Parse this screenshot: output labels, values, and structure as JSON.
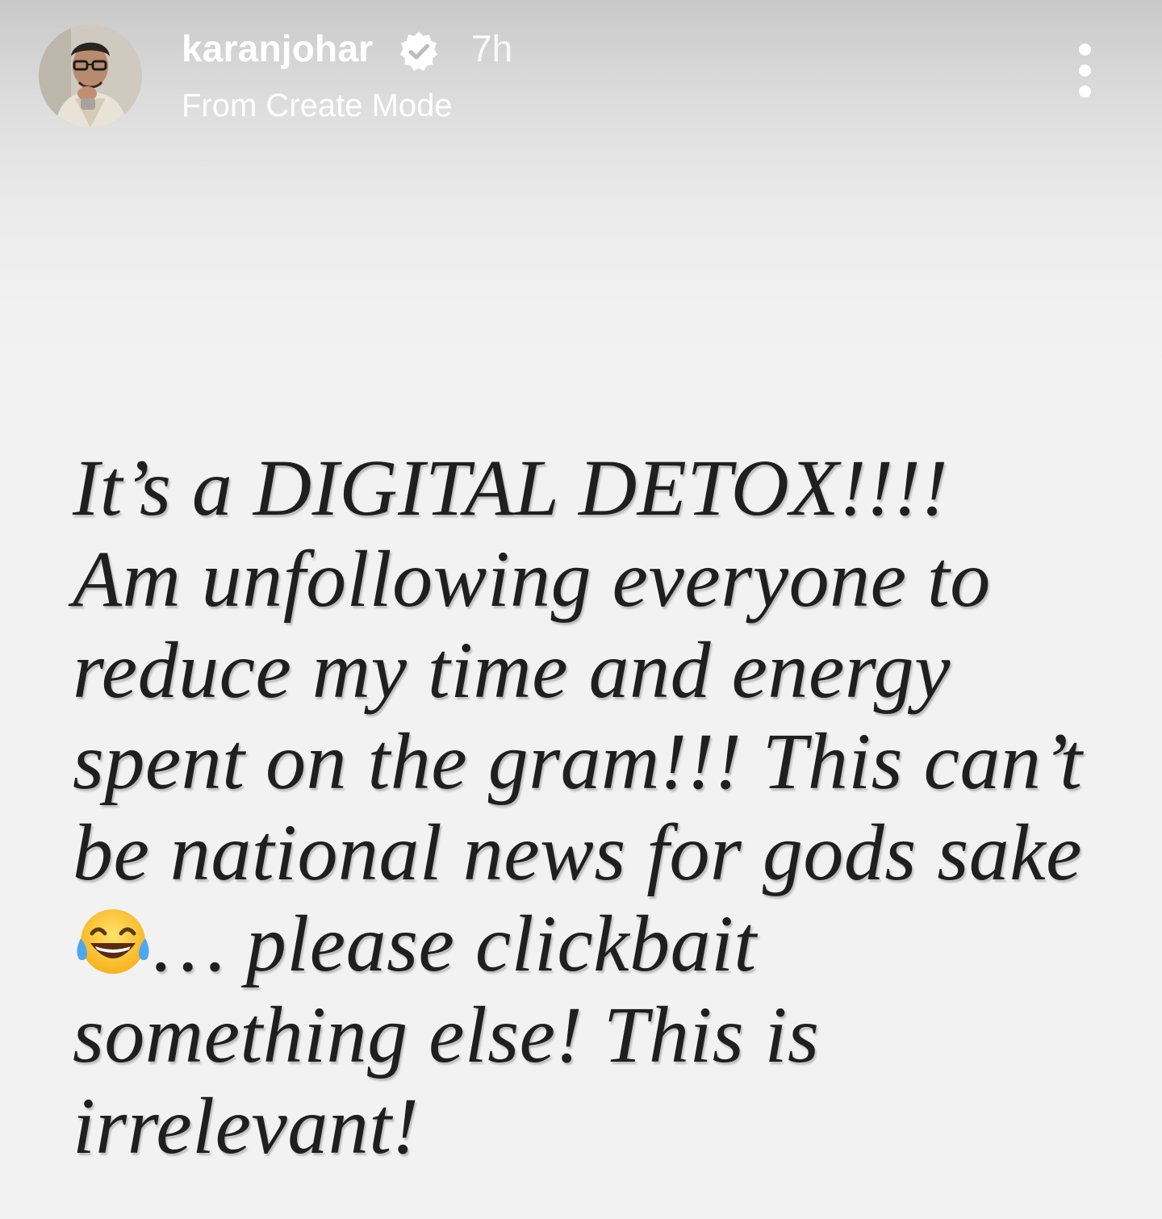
{
  "story": {
    "username": "karanjohar",
    "verified": true,
    "timestamp": "7h",
    "subtitle": "From Create Mode",
    "avatar_icon": "profile-photo",
    "more_icon": "more-vertical-icon"
  },
  "caption": {
    "lines": [
      "It’s a DIGITAL DETOX!!!!",
      "Am unfollowing everyone to",
      "reduce my time and energy",
      "spent on the gram!!! This can’t",
      "be national news for gods sake",
      "… please clickbait",
      "something else! This is",
      "irrelevant!"
    ],
    "emoji": "face-with-tears-of-joy"
  },
  "colors": {
    "header_text": "#ffffff",
    "caption_text": "#1f1f1f",
    "background": "#f2f2f2",
    "verified_badge": "#ffffff"
  }
}
